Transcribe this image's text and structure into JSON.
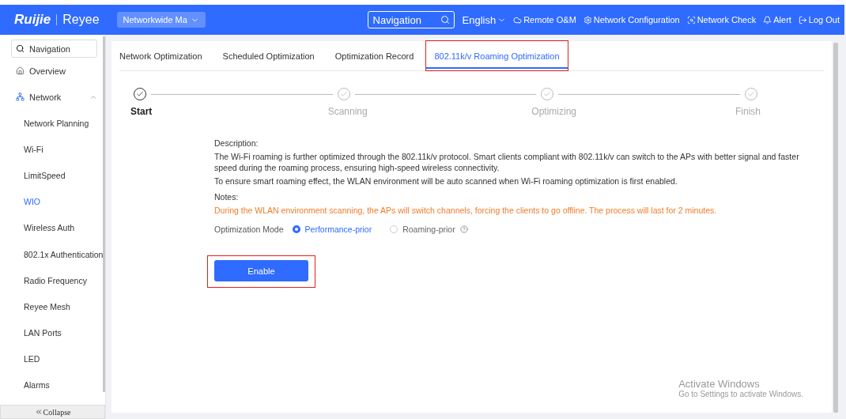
{
  "header": {
    "brand": "Ruijie",
    "product": "Reyee",
    "network_select": "Networkwide Ma",
    "search": {
      "placeholder": "Navigation"
    },
    "language": "English",
    "actions": [
      {
        "kind": "cloud",
        "label": "Remote O&M"
      },
      {
        "kind": "config",
        "label": "Network Configuration"
      },
      {
        "kind": "check",
        "label": "Network Check"
      },
      {
        "kind": "alert",
        "label": "Alert"
      },
      {
        "kind": "logout",
        "label": "Log Out"
      }
    ]
  },
  "sidebar": {
    "search": {
      "placeholder": "Navigation"
    },
    "items": [
      {
        "kind": "home",
        "label": "Overview",
        "selected": false
      },
      {
        "kind": "network",
        "label": "Network",
        "selected": false,
        "expanded": true,
        "children": [
          {
            "label": "Network Planning",
            "selected": false
          },
          {
            "label": "Wi-Fi",
            "selected": false
          },
          {
            "label": "LimitSpeed",
            "selected": false
          },
          {
            "label": "WIO",
            "selected": true
          },
          {
            "label": "Wireless Auth",
            "selected": false
          },
          {
            "label": "802.1x Authentication",
            "selected": false
          },
          {
            "label": "Radio Frequency",
            "selected": false
          },
          {
            "label": "Reyee Mesh",
            "selected": false
          },
          {
            "label": "LAN Ports",
            "selected": false
          },
          {
            "label": "LED",
            "selected": false
          },
          {
            "label": "Alarms",
            "selected": false
          }
        ]
      }
    ],
    "collapse": "Collapse"
  },
  "tabs": [
    {
      "label": "Network Optimization",
      "selected": false,
      "highlighted": false
    },
    {
      "label": "Scheduled Optimization",
      "selected": false,
      "highlighted": false
    },
    {
      "label": "Optimization Record",
      "selected": false,
      "highlighted": false
    },
    {
      "label": "802.11k/v Roaming Optimization",
      "selected": true,
      "highlighted": true
    }
  ],
  "steps": [
    {
      "label": "Start",
      "selected": true
    },
    {
      "label": "Scanning",
      "selected": false
    },
    {
      "label": "Optimizing",
      "selected": false
    },
    {
      "label": "Finish",
      "selected": false
    }
  ],
  "description": {
    "title": "Description:",
    "lines": [
      "The Wi-Fi roaming is further optimized through the 802.11k/v protocol. Smart clients compliant with 802.11k/v can switch to the APs with better signal and faster speed during the roaming process, ensuring high-speed wireless connectivity.",
      "To ensure smart roaming effect, the WLAN environment will be auto scanned when Wi-Fi roaming optimization is first enabled."
    ]
  },
  "notes": {
    "title": "Notes:",
    "text": "During the WLAN environment scanning, the APs will switch channels, forcing the clients to go offline. The process will last for 2 minutes."
  },
  "optimization_mode": {
    "label": "Optimization Mode",
    "options": [
      {
        "label": "Performance-prior",
        "selected": true,
        "help": false
      },
      {
        "label": "Roaming-prior",
        "selected": false,
        "help": true
      }
    ]
  },
  "enable_button": {
    "label": "Enable",
    "highlighted": true
  },
  "os_notice": {
    "title": "Activate Windows",
    "text": "Go to Settings to activate Windows."
  }
}
